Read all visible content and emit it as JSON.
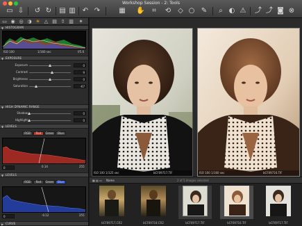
{
  "window": {
    "title": "Workshop Session - 2: Tools",
    "controls": {
      "close": "#ff5f57",
      "minimize": "#ffbd2e",
      "zoom": "#28c941"
    }
  },
  "toolbar": {
    "icons": [
      "folder-icon",
      "import-icon",
      "undo-rotate-icon",
      "reset-icon",
      "copy-icon",
      "trash-icon",
      "undo-icon",
      "redo-icon",
      "viewer-icon",
      "pan-icon",
      "crop-icon",
      "straighten-icon",
      "keystone-icon",
      "spot-icon",
      "picker-icon",
      "search-icon",
      "edit-icon",
      "warning-icon",
      "adjust-icon",
      "process-icon",
      "camera-icon",
      "close-icon"
    ]
  },
  "tool_tabs": [
    "library-icon",
    "capture-icon",
    "lens-icon",
    "color-icon",
    "exposure-icon",
    "detail-icon",
    "metadata-icon",
    "output-icon",
    "batch-icon",
    "adjustments-icon"
  ],
  "histogram": {
    "title": "HISTOGRAM",
    "iso": "ISO 100",
    "shutter": "1/160 sec",
    "aperture": "f/5.6"
  },
  "exposure": {
    "title": "EXPOSURE",
    "sliders": [
      {
        "label": "Exposure",
        "value": "0",
        "fraction": 0.5
      },
      {
        "label": "Contrast",
        "value": "9",
        "fraction": 0.55
      },
      {
        "label": "Brightness",
        "value": "0",
        "fraction": 0.5
      },
      {
        "label": "Saturation",
        "value": "-67",
        "fraction": 0.17
      }
    ]
  },
  "hdr": {
    "title": "HIGH DYNAMIC RANGE",
    "sliders": [
      {
        "label": "Shadow",
        "value": "0",
        "fraction": 0.0
      },
      {
        "label": "Highlight",
        "value": "0",
        "fraction": 0.0
      }
    ]
  },
  "levels1": {
    "title": "LEVELS",
    "tabs": [
      "RGB",
      "Red",
      "Green",
      "Blue"
    ],
    "active_tab": "Red",
    "active_color": "#c0392b",
    "low": "0",
    "mid": "0.14",
    "high": "255"
  },
  "levels2": {
    "title": "LEVELS",
    "tabs": [
      "RGB",
      "Red",
      "Green",
      "Blue"
    ],
    "active_tab": "Blue",
    "active_color": "#2f52c9",
    "low": "0",
    "mid": "-0.12",
    "high": "255"
  },
  "curve": {
    "title": "CURVE"
  },
  "viewer": {
    "left_photo": {
      "info_left": "ISO 100   1/125 sec",
      "info_right": "bCF09717.TIF"
    },
    "right_photo": {
      "info_left": "ISO 100   1/160 sec",
      "info_right": "bCF09716.TIF"
    }
  },
  "browser": {
    "sort_label": "Name",
    "count_text": "2 of 5 Images selected",
    "thumbs": [
      {
        "label": "bCF09717.CR2",
        "rating": "★ ★ ★ ★ ★"
      },
      {
        "label": "bCF09718.CR2",
        "rating": "★ ★ ★ ★ ★"
      },
      {
        "label": "bCF09717.TIF",
        "rating": "★ ★ ★ ★ ★"
      },
      {
        "label": "bCF09716.TIF",
        "rating": "★ ★ ★ ★ ★"
      },
      {
        "label": "bCF09717.TIF",
        "rating": "★ ★ ★ ★ ★"
      }
    ]
  }
}
